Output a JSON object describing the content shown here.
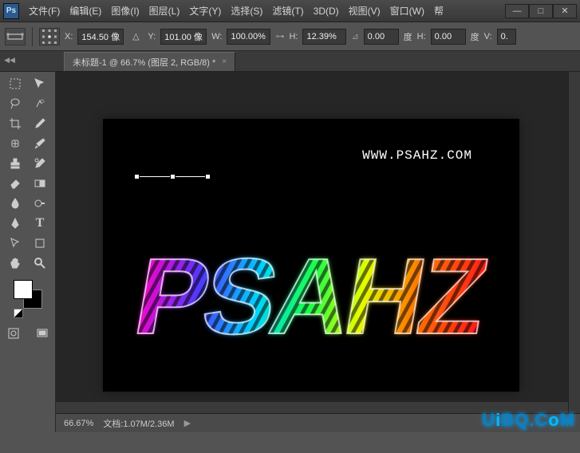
{
  "app": {
    "badge": "Ps"
  },
  "menu": [
    "文件(F)",
    "编辑(E)",
    "图像(I)",
    "图层(L)",
    "文字(Y)",
    "选择(S)",
    "滤镜(T)",
    "3D(D)",
    "视图(V)",
    "窗口(W)",
    "帮"
  ],
  "window_controls": {
    "min": "—",
    "max": "□",
    "close": "✕"
  },
  "options": {
    "x_label": "X:",
    "x_value": "154.50 像",
    "y_label": "Y:",
    "y_value": "101.00 像",
    "w_label": "W:",
    "w_value": "100.00%",
    "h_label": "H:",
    "h_value": "12.39%",
    "rot_value": "0.00",
    "rot_unit": "度",
    "h2_label": "H:",
    "h2_value": "0.00",
    "h2_unit": "度",
    "v_label": "V:",
    "v_value": "0."
  },
  "doc_tab": {
    "title": "未标题-1 @ 66.7% (图层 2, RGB/8) *",
    "close": "×"
  },
  "canvas": {
    "url_text": "WWW.PSAHZ.COM",
    "main_text": "PSAHZ"
  },
  "status": {
    "zoom": "66.67%",
    "doc_info": "文档:1.07M/2.36M",
    "play": "▶"
  },
  "watermark": "UiBQ.CoM",
  "tools": {
    "marquee": "marquee",
    "move": "move",
    "lasso": "lasso",
    "wand": "wand",
    "crop": "crop",
    "eyedrop": "eyedrop",
    "heal": "heal",
    "brush": "brush",
    "stamp": "stamp",
    "history": "history",
    "eraser": "eraser",
    "gradient": "gradient",
    "blur": "blur",
    "dodge": "dodge",
    "pen": "pen",
    "type": "type",
    "path": "path",
    "shape": "shape",
    "hand": "hand",
    "zoom": "zoom"
  }
}
